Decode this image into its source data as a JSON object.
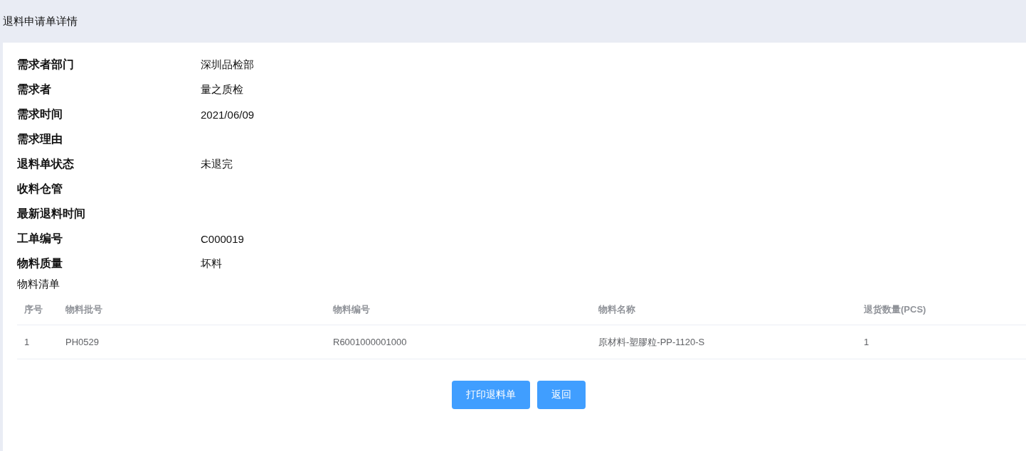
{
  "page_title": "退料申请单详情",
  "fields": [
    {
      "label": "需求者部门",
      "value": "深圳品检部"
    },
    {
      "label": "需求者",
      "value": "量之质检"
    },
    {
      "label": "需求时间",
      "value": "2021/06/09"
    },
    {
      "label": "需求理由"
    },
    {
      "label": "退料单状态",
      "value": "未退完"
    },
    {
      "label": "收料仓管"
    },
    {
      "label": "最新退料时间"
    },
    {
      "label": "工单编号",
      "value": "C000019"
    },
    {
      "label": "物料质量",
      "value": "坏料"
    }
  ],
  "materials": {
    "title": "物料清单",
    "columns": [
      "序号",
      "物料批号",
      "物料编号",
      "物料名称",
      "退货数量(PCS)"
    ],
    "rows": [
      [
        "1",
        "PH0529",
        "R6001000001000",
        "原材料-塑膠粒-PP-1120-S",
        "1"
      ]
    ]
  },
  "buttons": [
    "打印退料单",
    "返回"
  ]
}
